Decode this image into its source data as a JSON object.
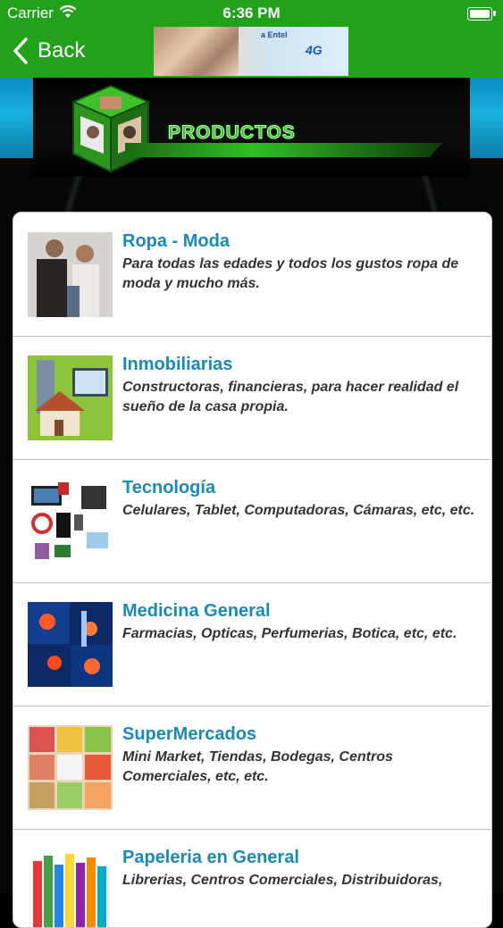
{
  "status_bar": {
    "carrier": "Carrier",
    "time": "6:36 PM"
  },
  "nav": {
    "back_label": "Back",
    "ad": {
      "line1": "a Entel",
      "line2": "",
      "badge": "4G",
      "line3": ""
    }
  },
  "header": {
    "title": "PRODUCTOS"
  },
  "colors": {
    "nav_green": "#22a11b",
    "item_title": "#1a8ab5",
    "accent_blue": "#1ab0dc"
  },
  "categories": [
    {
      "name": "Ropa - Moda",
      "description": "Para todas las edades y todos los gustos ropa de moda y mucho más.",
      "icon": "fashion-photo"
    },
    {
      "name": "Inmobiliarias",
      "description": "Constructoras, financieras, para hacer realidad el sueño de la casa propia.",
      "icon": "house-photo"
    },
    {
      "name": "Tecnología",
      "description": "Celulares, Tablet, Computadoras, Cámaras, etc, etc.",
      "icon": "electronics-photo"
    },
    {
      "name": "Medicina General",
      "description": "Farmacias, Opticas, Perfumerias, Botica, etc, etc.",
      "icon": "medical-photo"
    },
    {
      "name": "SuperMercados",
      "description": "Mini Market, Tiendas, Bodegas, Centros Comerciales, etc, etc.",
      "icon": "food-photo"
    },
    {
      "name": "Papeleria en General",
      "description": "Librerias, Centros Comerciales, Distribuidoras,",
      "icon": "stationery-photo"
    }
  ]
}
